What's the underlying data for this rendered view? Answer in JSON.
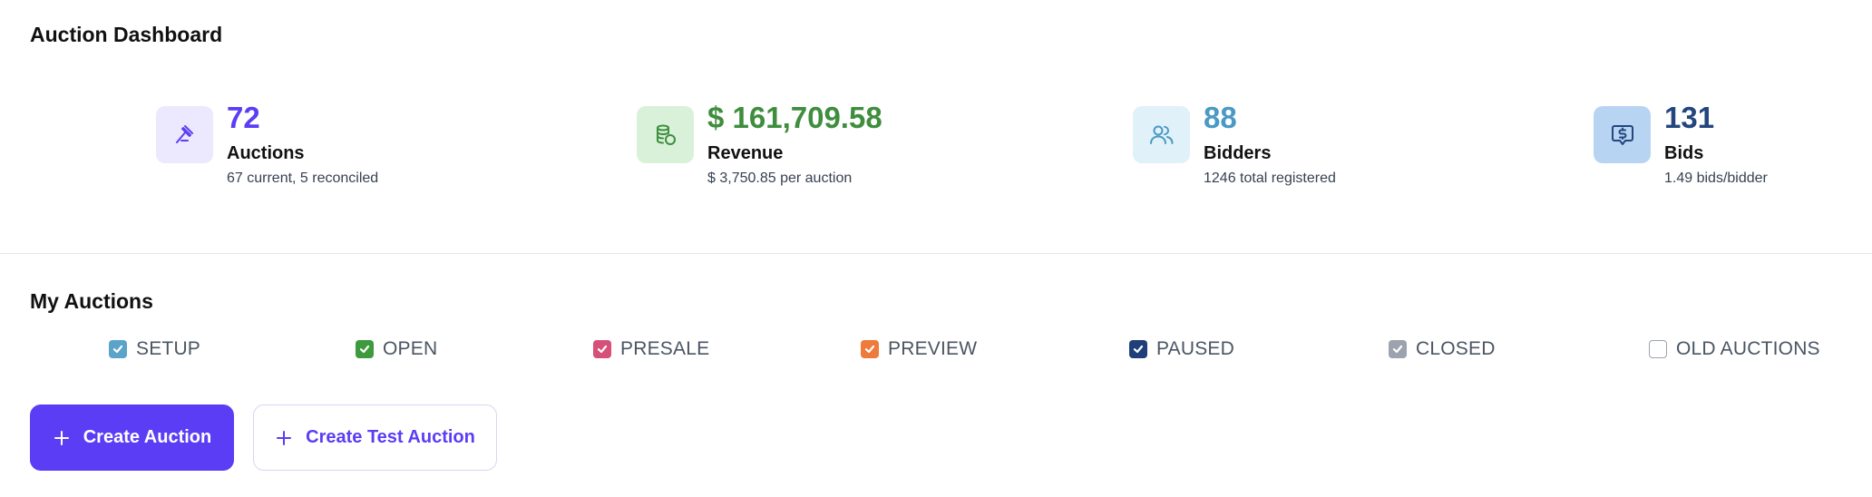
{
  "header": {
    "title": "Auction Dashboard"
  },
  "stats": [
    {
      "value": "72",
      "label": "Auctions",
      "sub": "67 current, 5 reconciled",
      "icon": "gavel-icon",
      "value_color": "#5b3df5",
      "icon_bg": "#ece8fd",
      "icon_color": "#5b3df5"
    },
    {
      "value": "$ 161,709.58",
      "label": "Revenue",
      "sub": "$ 3,750.85 per auction",
      "icon": "coins-icon",
      "value_color": "#3e8e3e",
      "icon_bg": "#d9f1d9",
      "icon_color": "#3e8e3e"
    },
    {
      "value": "88",
      "label": "Bidders",
      "sub": "1246 total registered",
      "icon": "users-icon",
      "value_color": "#4a9ac4",
      "icon_bg": "#e0f1fa",
      "icon_color": "#4a9ac4"
    },
    {
      "value": "131",
      "label": "Bids",
      "sub": "1.49 bids/bidder",
      "icon": "dollar-message-icon",
      "value_color": "#23467f",
      "icon_bg": "#b8d4f3",
      "icon_color": "#23467f"
    }
  ],
  "my_auctions": {
    "title": "My Auctions",
    "filters": [
      {
        "label": "SETUP",
        "checked": true,
        "color": "#5ba3c9"
      },
      {
        "label": "OPEN",
        "checked": true,
        "color": "#3e9a3e"
      },
      {
        "label": "PRESALE",
        "checked": true,
        "color": "#d6507a"
      },
      {
        "label": "PREVIEW",
        "checked": true,
        "color": "#ee7a3c"
      },
      {
        "label": "PAUSED",
        "checked": true,
        "color": "#1f3f7a"
      },
      {
        "label": "CLOSED",
        "checked": true,
        "color": "#9ca3af"
      },
      {
        "label": "OLD AUCTIONS",
        "checked": false,
        "color": "#9ca3af"
      }
    ]
  },
  "actions": {
    "create_label": "Create Auction",
    "create_test_label": "Create Test Auction"
  },
  "colors": {
    "accent": "#5b3df5",
    "divider": "#e5e7eb"
  }
}
